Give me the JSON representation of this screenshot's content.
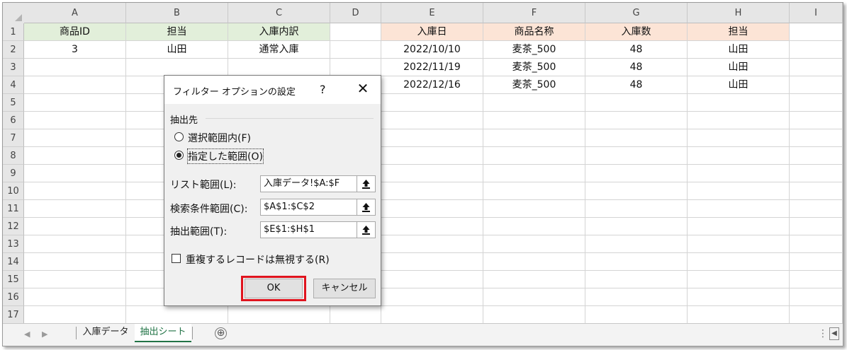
{
  "columns": [
    "A",
    "B",
    "C",
    "D",
    "E",
    "F",
    "G",
    "H",
    "I"
  ],
  "rows": [
    "1",
    "2",
    "3",
    "4",
    "5",
    "6",
    "7",
    "8",
    "9",
    "10",
    "11",
    "12",
    "13",
    "14",
    "15",
    "16",
    "17"
  ],
  "header_row": {
    "A": "商品ID",
    "B": "担当",
    "C": "入庫内訳",
    "E": "入庫日",
    "F": "商品名称",
    "G": "入庫数",
    "H": "担当"
  },
  "criteria_row": {
    "A": "3",
    "B": "山田",
    "C": "通常入庫"
  },
  "results": [
    {
      "date": "2022/10/10",
      "name": "麦茶_500",
      "qty": "48",
      "person": "山田"
    },
    {
      "date": "2022/11/19",
      "name": "麦茶_500",
      "qty": "48",
      "person": "山田"
    },
    {
      "date": "2022/12/16",
      "name": "麦茶_500",
      "qty": "48",
      "person": "山田"
    }
  ],
  "dialog": {
    "title": "フィルター オプションの設定",
    "help": "?",
    "close": "✕",
    "group_label": "抽出先",
    "radio_in_place": "選択範囲内(F)",
    "radio_copy": "指定した範囲(O)",
    "list_range_label": "リスト範囲(L):",
    "list_range_value": "入庫データ!$A:$F",
    "criteria_range_label": "検索条件範囲(C):",
    "criteria_range_value": "$A$1:$C$2",
    "copy_to_label": "抽出範囲(T):",
    "copy_to_value": "$E$1:$H$1",
    "unique_label": "重複するレコードは無視する(R)",
    "ok": "OK",
    "cancel": "キャンセル"
  },
  "tabs": [
    "入庫データ",
    "抽出シート"
  ],
  "active_tab": "抽出シート",
  "add_sheet": "⊕",
  "colors": {
    "criteria_header_fill": "#e2efda",
    "output_header_fill": "#fce4d6",
    "highlight": "#e0141e",
    "active_tab": "#217346"
  }
}
